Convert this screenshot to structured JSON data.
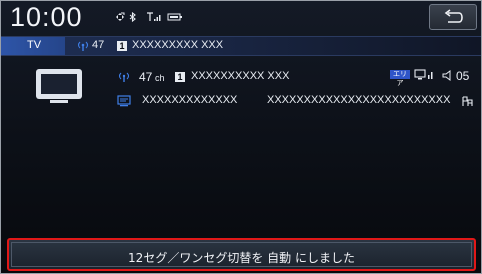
{
  "status": {
    "time": "10:00"
  },
  "station_bar": {
    "source": "TV",
    "channel": "47",
    "remote_number": "1",
    "station_name": "XXXXXXXXX XXX"
  },
  "details": {
    "channel": "47",
    "channel_unit": "ch",
    "remote_number": "1",
    "station_name": "XXXXXXXXXX XXX",
    "area_badge": "エリア",
    "volume": "05",
    "program_title": "XXXXXXXXXXXXX",
    "program_detail": "XXXXXXXXXXXXXXXXXXXXXXXXX"
  },
  "message": {
    "text": "12セグ／ワンセグ切替を 自動 にしました"
  },
  "colors": {
    "highlight_border": "#e01818",
    "source_tab": "#2e55a8",
    "background": "#0d1119"
  }
}
